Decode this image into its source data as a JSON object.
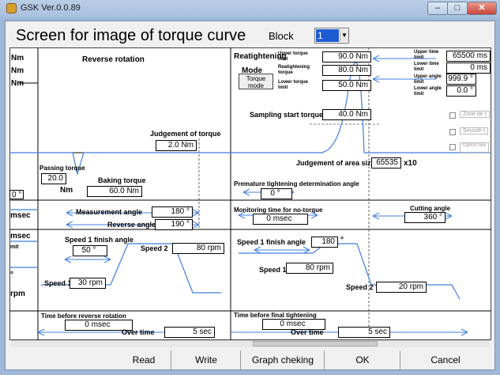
{
  "window": {
    "title": "GSK Ver.0.0.89"
  },
  "header": {
    "title": "Screen for image of torque curve",
    "block_label": "Block",
    "block_value": "1"
  },
  "left_top": {
    "units": [
      "Nm",
      "Nm",
      "Nm"
    ],
    "reverse_title": "Reverse rotation",
    "judgement_label": "Judgement of torque",
    "judgement_value": "2.0",
    "judgement_unit": "Nm",
    "passing_label": "Passing torque",
    "passing_value": "20.0",
    "passing_unit": "Nm",
    "baking_label": "Baking torque",
    "baking_value": "60.0",
    "baking_unit": "Nm",
    "degree_stub": "0 °"
  },
  "retightening": {
    "title": "Reatightening",
    "mode_label": "Mode",
    "mode_button": "Torque mode",
    "upper_label": "Upper torque limit",
    "upper_value": "90.0",
    "retight_label": "Reatightening torque",
    "retight_value": "80.0",
    "lower_label": "Lower torque limit",
    "lower_value": "50.0",
    "unit": "Nm",
    "sampling_label": "Sampling start torque",
    "sampling_value": "40.0"
  },
  "right_limits": {
    "upper_time_label": "Upper time limit",
    "upper_time_value": "65500",
    "upper_time_unit": "ms",
    "lower_time_label": "Lower time limit",
    "lower_time_value": "0",
    "lower_time_unit": "ms",
    "upper_angle_label": "Upper angle limit",
    "upper_angle_value": "999.9",
    "lower_angle_label": "Lower angle limit",
    "lower_angle_value": "0.0",
    "deg": "°"
  },
  "checkboxes": [
    "Zone de t",
    "Smooth t",
    "Option nex"
  ],
  "judgement_area": {
    "label": "Judgement of area size",
    "value": "65535",
    "unit": "x10"
  },
  "premature": {
    "label": "Premature tightening determination angle",
    "value": "0",
    "deg": "°"
  },
  "angles": {
    "measurement_label": "Measurement angle",
    "measurement_value": "180",
    "reverse_label": "Reverse angle",
    "reverse_value": "190",
    "deg": "°",
    "monitoring_label": "Monitoring time for no-torque",
    "monitoring_value": "0",
    "monitoring_unit": "msec",
    "cutting_label": "Cutting angle",
    "cutting_value": "360"
  },
  "left_stubs": [
    "msec",
    "msec",
    "mit",
    "rpm",
    "°"
  ],
  "speed_left": {
    "finish_label": "Speed 1 finish angle",
    "finish_value": "50",
    "speed1_label": "Speed 1",
    "speed1_value": "30",
    "speed2_label": "Speed 2",
    "speed2_value": "80",
    "unit": "rpm",
    "deg": "°"
  },
  "speed_right": {
    "finish_label": "Speed 1 finish angle",
    "finish_value": "180",
    "speed1_label": "Speed 1",
    "speed1_value": "80",
    "speed2_label": "Speed 2",
    "speed2_value": "20",
    "unit": "rpm",
    "deg": "°"
  },
  "bottom_left": {
    "label": "Time before reverse rotation",
    "time_value": "0",
    "time_unit": "msec",
    "over_label": "Over time",
    "over_value": "5",
    "over_unit": "sec"
  },
  "bottom_right": {
    "label": "Time before final tightening",
    "time_value": "0",
    "time_unit": "msec",
    "over_label": "Over time",
    "over_value": "5",
    "over_unit": "sec"
  },
  "footer": {
    "read": "Read",
    "write": "Write",
    "graph": "Graph cheking",
    "ok": "OK",
    "cancel": "Cancel"
  },
  "colors": {
    "curve": "#3f7fe0",
    "selection": "#1e5bd2"
  }
}
